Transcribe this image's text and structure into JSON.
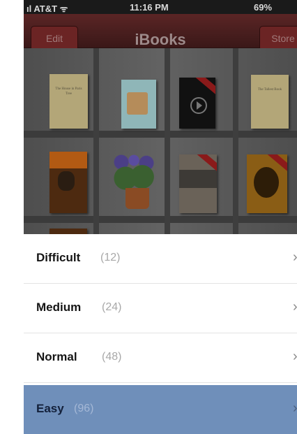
{
  "status_bar": {
    "carrier": "ıl AT&T ᯤ",
    "time": "11:16 PM",
    "battery": "69%"
  },
  "nav": {
    "title": "iBooks",
    "left_button": "Edit",
    "right_button": "Store"
  },
  "shelf_books": [
    {
      "text": "The House in Paris Tree"
    },
    {
      "text": "The Tallest Book"
    }
  ],
  "list": {
    "items": [
      {
        "label": "Difficult",
        "count": "(12)",
        "chevron": "›"
      },
      {
        "label": "Medium",
        "count": "(24)",
        "chevron": "›"
      },
      {
        "label": "Normal",
        "count": "(48)",
        "chevron": "›"
      },
      {
        "label": "Easy",
        "count": "(96)",
        "chevron": "›"
      }
    ],
    "selected_index": 3,
    "selected_color": "#6f8fba"
  }
}
